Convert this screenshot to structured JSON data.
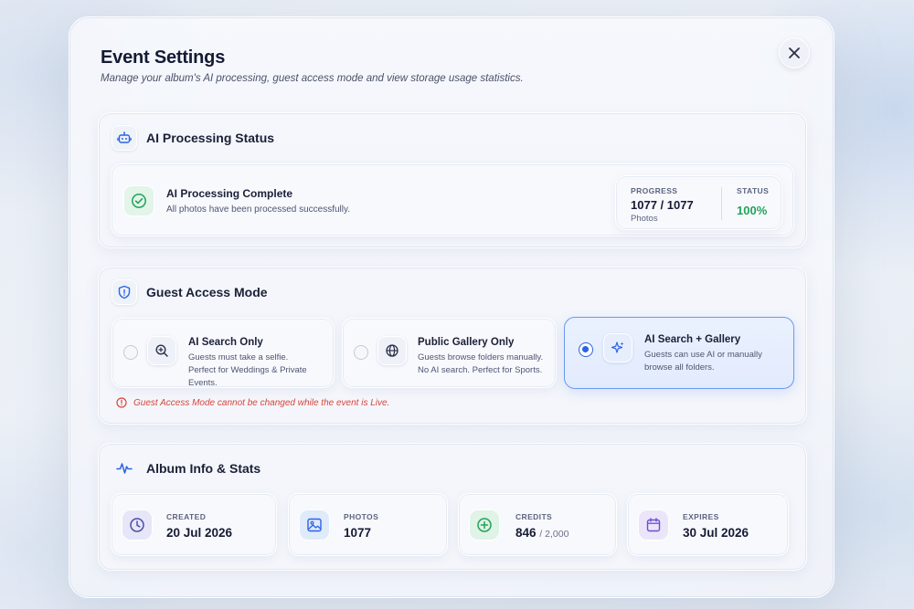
{
  "modal": {
    "title": "Event Settings",
    "subtitle": "Manage your album's AI processing, guest access mode and view storage usage statistics.",
    "close_icon": "close-icon"
  },
  "ai_processing": {
    "section_title": "AI Processing Status",
    "icon": "robot-icon",
    "status_title": "AI Processing Complete",
    "status_desc": "All photos have been processed successfully.",
    "status_icon": "check-circle-icon",
    "progress_caption": "PROGRESS",
    "progress_value": "1077 / 1077",
    "progress_unit": "Photos",
    "status_caption": "STATUS",
    "status_value": "100%",
    "progress_fraction": 1.0,
    "accent": "#22a35a"
  },
  "guest_access": {
    "section_title": "Guest Access Mode",
    "icon": "shield-icon",
    "options": [
      {
        "title": "AI Search Only",
        "desc1": "Guests must take a selfie.",
        "desc2": "Perfect for Weddings & Private Events.",
        "icon": "search-zoom-icon",
        "selected": false
      },
      {
        "title": "Public Gallery Only",
        "desc1": "Guests browse folders manually.",
        "desc2": "No AI search. Perfect for Sports.",
        "icon": "globe-icon",
        "selected": false
      },
      {
        "title": "AI Search + Gallery",
        "desc1": "Guests can use AI or manually",
        "desc2": "browse all folders.",
        "icon": "sparkles-icon",
        "selected": true
      }
    ],
    "warning": "Guest Access Mode cannot be changed while the event is Live.",
    "warning_icon": "alert-circle-icon",
    "warning_color": "#d6453d",
    "selected_color": "#2b63e6"
  },
  "album_info": {
    "section_title": "Album Info & Stats",
    "icon": "activity-icon",
    "stats": [
      {
        "caption": "CREATED",
        "value": "20 Jul 2026",
        "icon": "clock-icon"
      },
      {
        "caption": "PHOTOS",
        "value": "1077",
        "icon": "image-icon"
      },
      {
        "caption": "CREDITS",
        "value": "846",
        "total": "/ 2,000",
        "icon": "plus-circle-icon"
      },
      {
        "caption": "EXPIRES",
        "value": "30 Jul 2026",
        "icon": "calendar-icon"
      }
    ]
  }
}
